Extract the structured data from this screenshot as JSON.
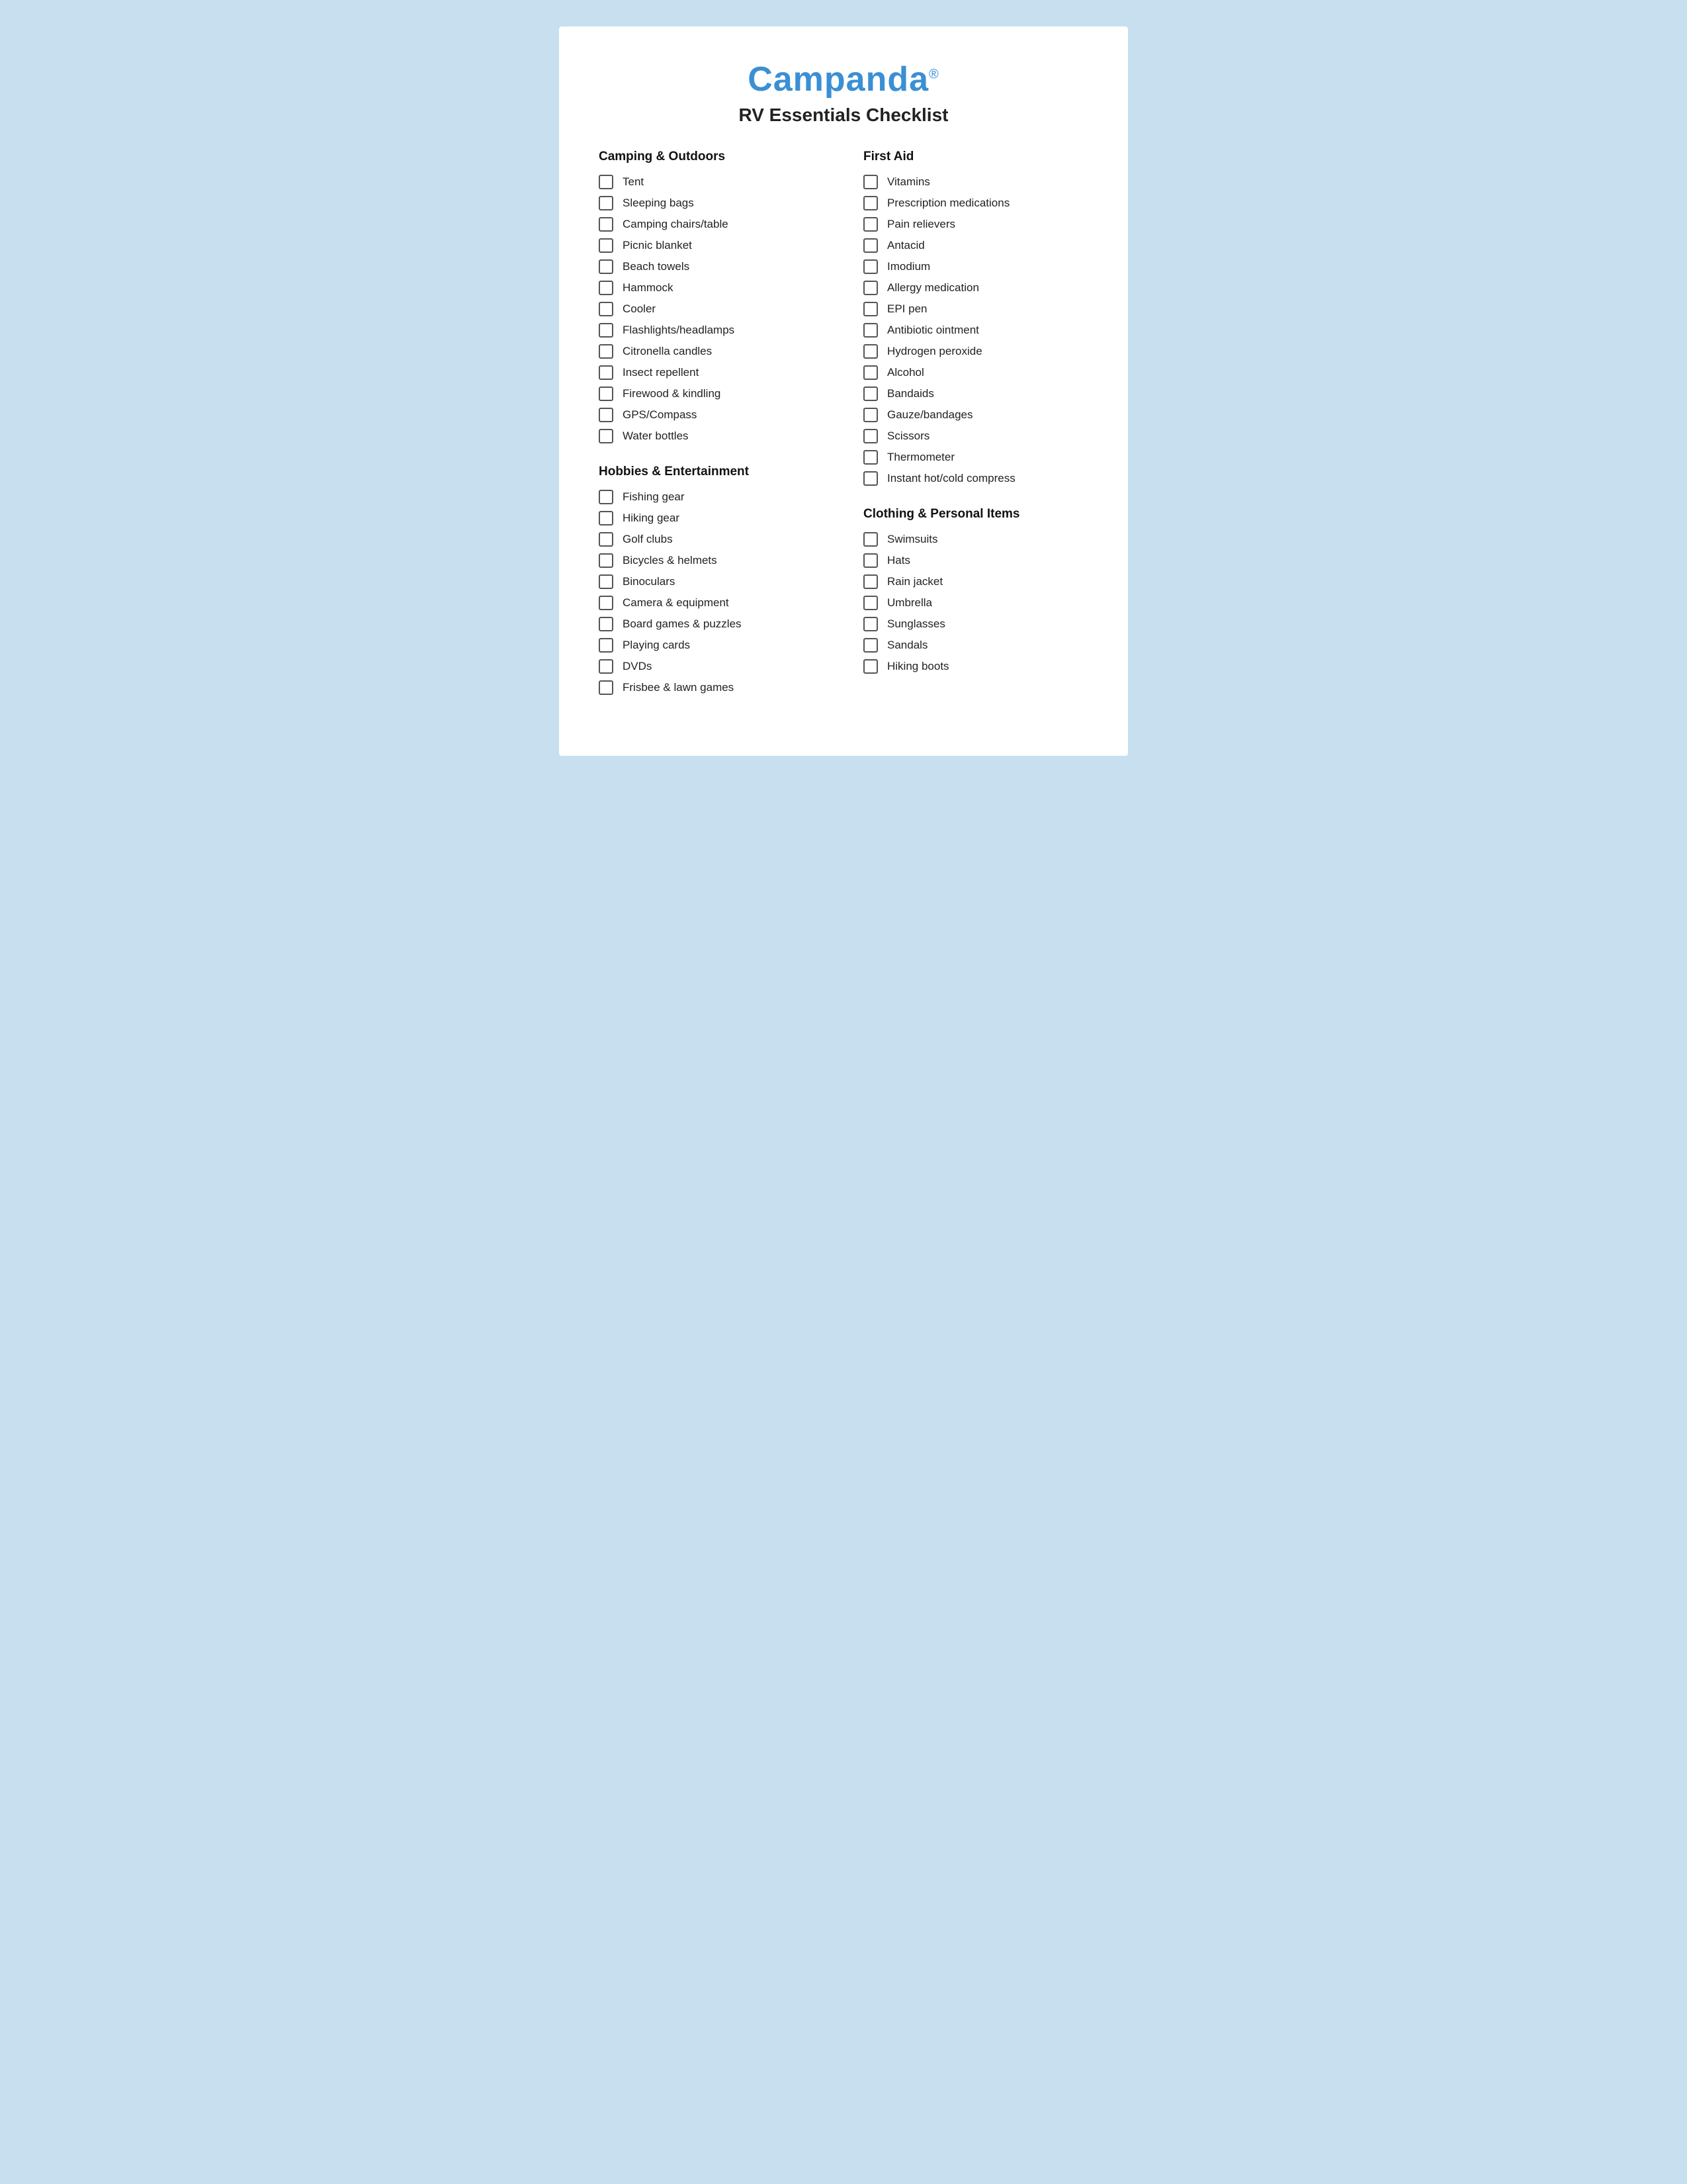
{
  "logo": {
    "text": "Campanda",
    "reg": "®"
  },
  "main_title": "RV Essentials Checklist",
  "sections": {
    "camping": {
      "title": "Camping & Outdoors",
      "items": [
        "Tent",
        "Sleeping bags",
        "Camping chairs/table",
        "Picnic blanket",
        "Beach towels",
        "Hammock",
        "Cooler",
        "Flashlights/headlamps",
        "Citronella candles",
        "Insect repellent",
        "Firewood & kindling",
        "GPS/Compass",
        "Water bottles"
      ]
    },
    "first_aid": {
      "title": "First Aid",
      "items": [
        "Vitamins",
        "Prescription medications",
        "Pain relievers",
        "Antacid",
        "Imodium",
        "Allergy medication",
        "EPI pen",
        "Antibiotic ointment",
        "Hydrogen peroxide",
        "Alcohol",
        "Bandaids",
        "Gauze/bandages",
        "Scissors",
        "Thermometer",
        "Instant hot/cold compress"
      ]
    },
    "hobbies": {
      "title": "Hobbies & Entertainment",
      "items": [
        "Fishing gear",
        "Hiking gear",
        "Golf clubs",
        "Bicycles & helmets",
        "Binoculars",
        "Camera & equipment",
        "Board games & puzzles",
        "Playing cards",
        "DVDs",
        "Frisbee & lawn games"
      ]
    },
    "clothing": {
      "title": "Clothing & Personal Items",
      "items": [
        "Swimsuits",
        "Hats",
        "Rain jacket",
        "Umbrella",
        "Sunglasses",
        "Sandals",
        "Hiking boots"
      ]
    }
  }
}
